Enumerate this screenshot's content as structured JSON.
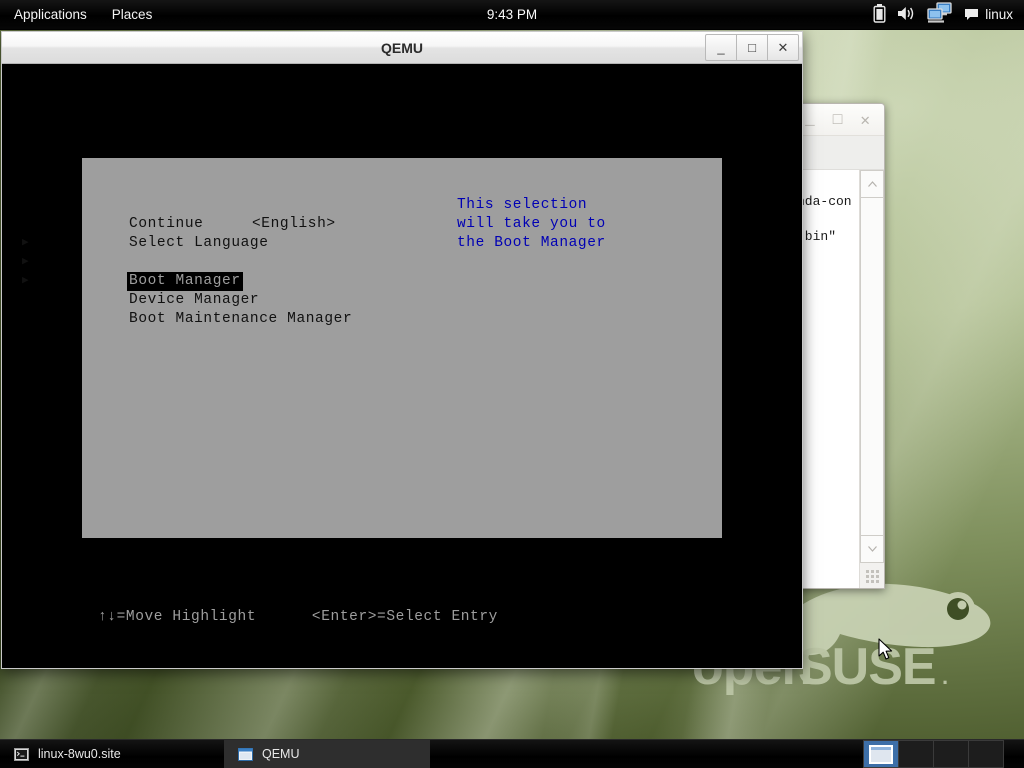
{
  "top_panel": {
    "applications_label": "Applications",
    "places_label": "Places",
    "clock": "9:43 PM",
    "user_label": "linux",
    "icons": {
      "battery": "battery-icon",
      "volume": "volume-icon",
      "network_display": "network-display-icon",
      "chat": "chat-bubble-icon"
    }
  },
  "qemu_window": {
    "title": "QEMU",
    "buttons": {
      "minimize": "_",
      "maximize": "□",
      "close": "✕"
    }
  },
  "bios": {
    "menu": [
      {
        "label": "Continue",
        "value": "",
        "has_arrow": false,
        "selected": false
      },
      {
        "label": "Select Language",
        "value": "<English>",
        "has_arrow": false,
        "selected": false
      },
      {
        "label": "Boot Manager",
        "value": "",
        "has_arrow": true,
        "selected": true
      },
      {
        "label": "Device Manager",
        "value": "",
        "has_arrow": true,
        "selected": false
      },
      {
        "label": "Boot Maintenance Manager",
        "value": "",
        "has_arrow": true,
        "selected": false
      }
    ],
    "help_text": "This selection will take you to the Boot Manager",
    "footer": "↑↓=Move Highlight      <Enter>=Select Entry",
    "colors": {
      "panel_bg": "#9e9e9e",
      "help_text": "#0000b4",
      "screen_bg": "#000000"
    }
  },
  "background_window": {
    "buttons": {
      "minimize": "_",
      "maximize": "□",
      "close": "✕"
    },
    "visible_text_lines": [
      "nda-con",
      ".bin\""
    ],
    "scrollbar": {
      "up_arrow": "▲",
      "down_arrow": "▼"
    }
  },
  "taskbar": {
    "items": [
      {
        "label": "linux-8wu0.site",
        "icon": "terminal-icon",
        "active": false
      },
      {
        "label": "QEMU",
        "icon": "window-icon",
        "active": true
      }
    ],
    "workspaces": [
      {
        "active": true
      },
      {
        "active": false
      },
      {
        "active": false
      },
      {
        "active": false
      }
    ]
  }
}
